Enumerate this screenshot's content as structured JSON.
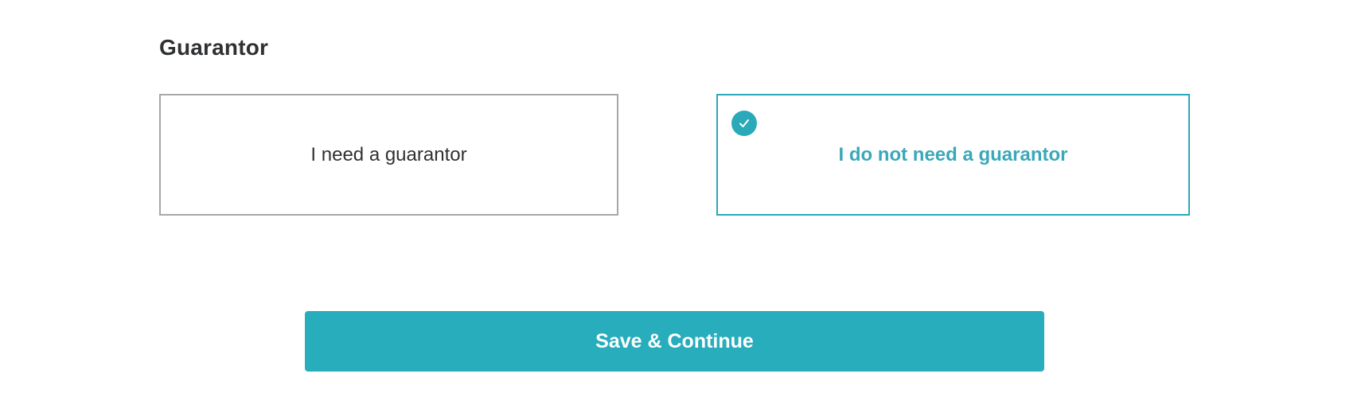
{
  "section": {
    "title": "Guarantor"
  },
  "options": {
    "need": {
      "label": "I need a guarantor",
      "selected": false
    },
    "not_need": {
      "label": "I do not need a guarantor",
      "selected": true,
      "icon": "checkmark-icon"
    }
  },
  "actions": {
    "save_label": "Save & Continue"
  },
  "colors": {
    "accent": "#27adbb",
    "unselected_border": "#a7a7a7",
    "text": "#2f3133"
  }
}
